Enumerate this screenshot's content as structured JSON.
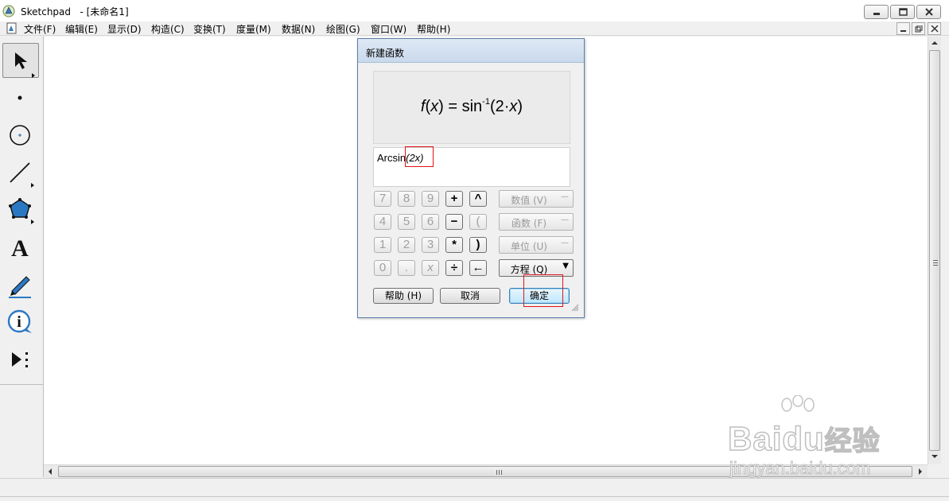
{
  "window": {
    "app_name": "Sketchpad",
    "document_title": "- [未命名1]"
  },
  "menu": {
    "items": [
      "文件(F)",
      "编辑(E)",
      "显示(D)",
      "构造(C)",
      "变换(T)",
      "度量(M)",
      "数据(N)",
      "绘图(G)",
      "窗口(W)",
      "帮助(H)"
    ]
  },
  "toolbox": {
    "tools": [
      "selection-arrow-tool",
      "point-tool",
      "compass-tool",
      "straightedge-tool",
      "polygon-tool",
      "text-tool",
      "marker-tool",
      "information-tool",
      "custom-tool"
    ],
    "text_tool_glyph": "A",
    "info_tool_glyph": "i",
    "selected_tool": "selection-arrow-tool"
  },
  "dialog": {
    "title": "新建函数",
    "preview": {
      "func_name": "f",
      "var": "x",
      "equals_fn": " = sin",
      "exponent": "-1",
      "arg_open": "(2·",
      "arg_var": "x",
      "arg_close": ")"
    },
    "expression": {
      "prefix": "Arcsin",
      "arg": "(2x)"
    },
    "keypad": {
      "row1": [
        "7",
        "8",
        "9",
        "+",
        "^"
      ],
      "row2": [
        "4",
        "5",
        "6",
        "−",
        "("
      ],
      "row3": [
        "1",
        "2",
        "3",
        "*",
        ")"
      ],
      "row4": [
        "0",
        ".",
        "x",
        "÷",
        "←"
      ]
    },
    "dropdowns": {
      "value": "数值 (V)",
      "function": "函数 (F)",
      "unit": "单位 (U)",
      "equation": "方程 (Q)"
    },
    "buttons": {
      "help": "帮助 (H)",
      "cancel": "取消",
      "ok": "确定"
    }
  },
  "watermark": {
    "brand_text": "Bai",
    "brand_paw": "du",
    "brand_cn": "经验",
    "site": "jingyan.baidu.com"
  },
  "colors": {
    "highlight": "#e0141a",
    "dialog_border": "#5d7ea8",
    "default_button": "#3c7fb1"
  }
}
